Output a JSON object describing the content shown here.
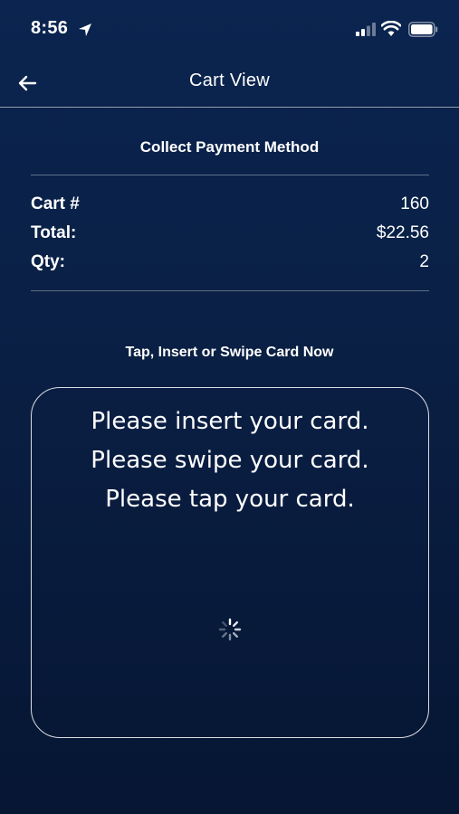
{
  "status_bar": {
    "time": "8:56",
    "icons": [
      "location-arrow-icon",
      "signal-icon",
      "wifi-icon",
      "battery-icon"
    ]
  },
  "nav": {
    "title": "Cart View",
    "back_icon": "back-arrow-icon"
  },
  "payment": {
    "section_title": "Collect Payment Method",
    "rows": [
      {
        "label": "Cart #",
        "value": "160"
      },
      {
        "label": "Total:",
        "value": "$22.56"
      },
      {
        "label": "Qty:",
        "value": "2"
      }
    ],
    "prompt": "Tap, Insert or Swipe Card Now"
  },
  "card_reader": {
    "messages": [
      "Please insert your card.",
      "Please swipe your card.",
      "Please tap your card."
    ],
    "loading_icon": "spinner-icon"
  },
  "colors": {
    "background_top": "#0b2550",
    "background_bottom": "#061633",
    "text": "#ffffff"
  }
}
